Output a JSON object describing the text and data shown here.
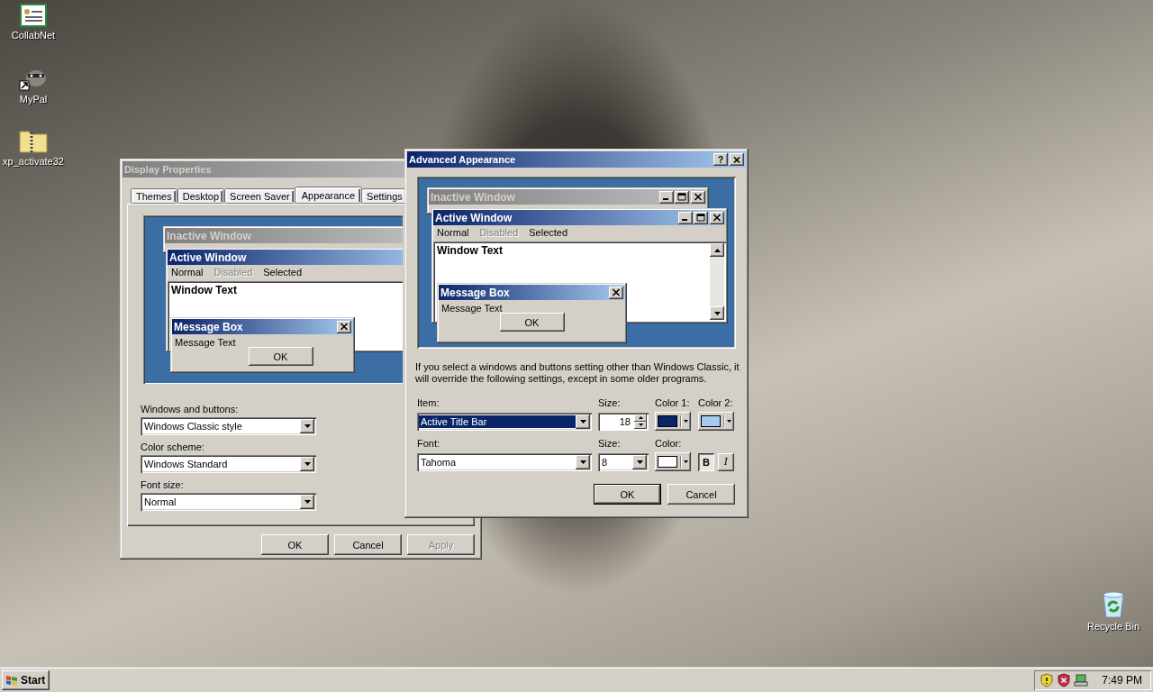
{
  "desktop_icons": [
    {
      "label": "CollabNet",
      "kind": "certificate"
    },
    {
      "label": "MyPal",
      "kind": "shortcut"
    },
    {
      "label": "xp_activate32",
      "kind": "zip"
    }
  ],
  "recycle_bin": {
    "label": "Recycle Bin"
  },
  "display_properties": {
    "title": "Display Properties",
    "active": false,
    "tabs": [
      {
        "label": "Themes",
        "selected": false
      },
      {
        "label": "Desktop",
        "selected": false
      },
      {
        "label": "Screen Saver",
        "selected": false
      },
      {
        "label": "Appearance",
        "selected": true
      },
      {
        "label": "Settings",
        "selected": false
      }
    ],
    "preview": {
      "inactive_title": "Inactive Window",
      "active_title": "Active Window",
      "menu": [
        {
          "label": "Normal",
          "disabled": false
        },
        {
          "label": "Disabled",
          "disabled": true
        },
        {
          "label": "Selected",
          "disabled": false
        }
      ],
      "window_text": "Window Text",
      "message_title": "Message Box",
      "message_text": "Message Text",
      "button": "OK"
    },
    "fields": [
      {
        "label": "Windows and buttons:",
        "value": "Windows Classic style"
      },
      {
        "label": "Color scheme:",
        "value": "Windows Standard"
      },
      {
        "label": "Font size:",
        "value": "Normal"
      }
    ],
    "buttons": [
      {
        "label": "OK",
        "disabled": false
      },
      {
        "label": "Cancel",
        "disabled": false
      },
      {
        "label": "Apply",
        "disabled": true
      }
    ]
  },
  "advanced_appearance": {
    "title": "Advanced Appearance",
    "active": true,
    "help": "?",
    "preview": {
      "inactive_title": "Inactive Window",
      "active_title": "Active Window",
      "menu": [
        {
          "label": "Normal",
          "disabled": false
        },
        {
          "label": "Disabled",
          "disabled": true
        },
        {
          "label": "Selected",
          "disabled": false
        }
      ],
      "window_text": "Window Text",
      "message_title": "Message Box",
      "message_text": "Message Text",
      "button": "OK"
    },
    "note": "If you select a windows and buttons setting other than Windows Classic, it will override the following settings, except in some older programs.",
    "item": {
      "label": "Item:",
      "value": "Active Title Bar",
      "focused": true
    },
    "item_size": {
      "label": "Size:",
      "value": "18"
    },
    "color_1": {
      "label": "Color 1:",
      "color": "#0a246a"
    },
    "color_2": {
      "label": "Color 2:",
      "color": "#a6caf0"
    },
    "font": {
      "label": "Font:",
      "value": "Tahoma"
    },
    "font_size": {
      "label": "Size:",
      "value": "8"
    },
    "font_color": {
      "label": "Color:",
      "color": "#ffffff"
    },
    "bold": {
      "label": "B",
      "on": true
    },
    "italic": {
      "label": "I",
      "on": false
    },
    "buttons": [
      {
        "label": "OK",
        "default": true
      },
      {
        "label": "Cancel",
        "default": false
      }
    ]
  },
  "taskbar": {
    "start": "Start",
    "clock": "7:49 PM"
  }
}
